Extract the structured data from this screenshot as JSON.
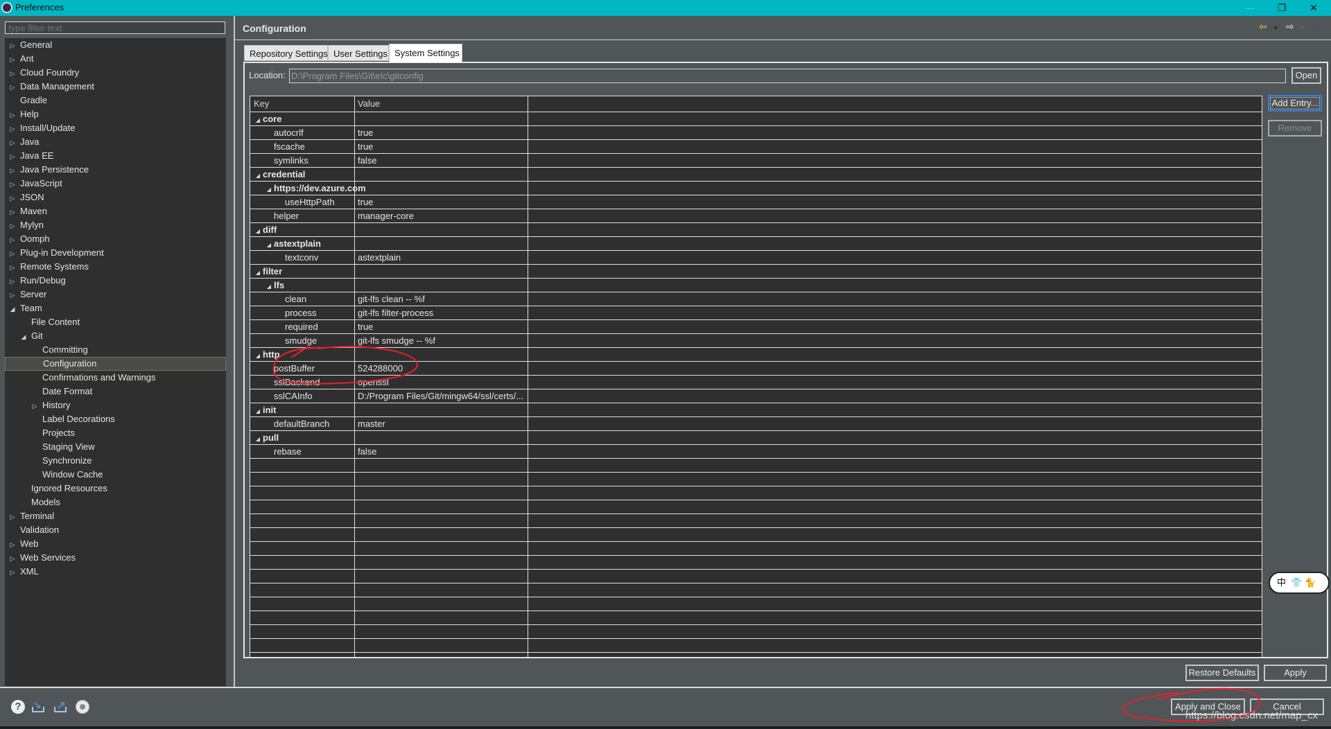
{
  "window": {
    "title": "Preferences",
    "controls": {
      "minimize": "—",
      "maximize": "❐",
      "close": "✕"
    }
  },
  "sidebar": {
    "filter_placeholder": "type filter text",
    "selected": "Configuration",
    "items": [
      {
        "label": "General",
        "level": 0,
        "toggle": "collapsed"
      },
      {
        "label": "Ant",
        "level": 0,
        "toggle": "collapsed"
      },
      {
        "label": "Cloud Foundry",
        "level": 0,
        "toggle": "collapsed"
      },
      {
        "label": "Data Management",
        "level": 0,
        "toggle": "collapsed"
      },
      {
        "label": "Gradle",
        "level": 0,
        "toggle": "none"
      },
      {
        "label": "Help",
        "level": 0,
        "toggle": "collapsed"
      },
      {
        "label": "Install/Update",
        "level": 0,
        "toggle": "collapsed"
      },
      {
        "label": "Java",
        "level": 0,
        "toggle": "collapsed"
      },
      {
        "label": "Java EE",
        "level": 0,
        "toggle": "collapsed"
      },
      {
        "label": "Java Persistence",
        "level": 0,
        "toggle": "collapsed"
      },
      {
        "label": "JavaScript",
        "level": 0,
        "toggle": "collapsed"
      },
      {
        "label": "JSON",
        "level": 0,
        "toggle": "collapsed"
      },
      {
        "label": "Maven",
        "level": 0,
        "toggle": "collapsed"
      },
      {
        "label": "Mylyn",
        "level": 0,
        "toggle": "collapsed"
      },
      {
        "label": "Oomph",
        "level": 0,
        "toggle": "collapsed"
      },
      {
        "label": "Plug-in Development",
        "level": 0,
        "toggle": "collapsed"
      },
      {
        "label": "Remote Systems",
        "level": 0,
        "toggle": "collapsed"
      },
      {
        "label": "Run/Debug",
        "level": 0,
        "toggle": "collapsed"
      },
      {
        "label": "Server",
        "level": 0,
        "toggle": "collapsed"
      },
      {
        "label": "Team",
        "level": 0,
        "toggle": "expanded"
      },
      {
        "label": "File Content",
        "level": 1,
        "toggle": "none"
      },
      {
        "label": "Git",
        "level": 1,
        "toggle": "expanded"
      },
      {
        "label": "Committing",
        "level": 2,
        "toggle": "none"
      },
      {
        "label": "Configuration",
        "level": 2,
        "toggle": "none"
      },
      {
        "label": "Confirmations and Warnings",
        "level": 2,
        "toggle": "none"
      },
      {
        "label": "Date Format",
        "level": 2,
        "toggle": "none"
      },
      {
        "label": "History",
        "level": 2,
        "toggle": "collapsed"
      },
      {
        "label": "Label Decorations",
        "level": 2,
        "toggle": "none"
      },
      {
        "label": "Projects",
        "level": 2,
        "toggle": "none"
      },
      {
        "label": "Staging View",
        "level": 2,
        "toggle": "none"
      },
      {
        "label": "Synchronize",
        "level": 2,
        "toggle": "none"
      },
      {
        "label": "Window Cache",
        "level": 2,
        "toggle": "none"
      },
      {
        "label": "Ignored Resources",
        "level": 1,
        "toggle": "none"
      },
      {
        "label": "Models",
        "level": 1,
        "toggle": "none"
      },
      {
        "label": "Terminal",
        "level": 0,
        "toggle": "collapsed"
      },
      {
        "label": "Validation",
        "level": 0,
        "toggle": "none"
      },
      {
        "label": "Web",
        "level": 0,
        "toggle": "collapsed"
      },
      {
        "label": "Web Services",
        "level": 0,
        "toggle": "collapsed"
      },
      {
        "label": "XML",
        "level": 0,
        "toggle": "collapsed"
      }
    ]
  },
  "header": {
    "title": "Configuration",
    "nav": {
      "back": "⇦",
      "forward": "⇨",
      "dropdown": "▾"
    }
  },
  "tabs": [
    {
      "label": "Repository Settings",
      "active": false
    },
    {
      "label": "User Settings",
      "active": false
    },
    {
      "label": "System Settings",
      "active": true
    }
  ],
  "location": {
    "label": "Location:",
    "value": "D:\\Program Files\\Git\\etc\\gitconfig",
    "open_button": "Open"
  },
  "side_buttons": {
    "add": "Add Entry...",
    "remove": "Remove"
  },
  "table": {
    "columns": [
      "Key",
      "Value"
    ],
    "rows": [
      {
        "key": "core",
        "value": "",
        "level": 0,
        "group": true
      },
      {
        "key": "autocrlf",
        "value": "true",
        "level": 1,
        "group": false
      },
      {
        "key": "fscache",
        "value": "true",
        "level": 1,
        "group": false
      },
      {
        "key": "symlinks",
        "value": "false",
        "level": 1,
        "group": false
      },
      {
        "key": "credential",
        "value": "",
        "level": 0,
        "group": true
      },
      {
        "key": "https://dev.azure.com",
        "value": "",
        "level": 1,
        "group": true
      },
      {
        "key": "useHttpPath",
        "value": "true",
        "level": 2,
        "group": false
      },
      {
        "key": "helper",
        "value": "manager-core",
        "level": 1,
        "group": false
      },
      {
        "key": "diff",
        "value": "",
        "level": 0,
        "group": true
      },
      {
        "key": "astextplain",
        "value": "",
        "level": 1,
        "group": true
      },
      {
        "key": "textconv",
        "value": "astextplain",
        "level": 2,
        "group": false
      },
      {
        "key": "filter",
        "value": "",
        "level": 0,
        "group": true
      },
      {
        "key": "lfs",
        "value": "",
        "level": 1,
        "group": true
      },
      {
        "key": "clean",
        "value": "git-lfs clean -- %f",
        "level": 2,
        "group": false
      },
      {
        "key": "process",
        "value": "git-lfs filter-process",
        "level": 2,
        "group": false
      },
      {
        "key": "required",
        "value": "true",
        "level": 2,
        "group": false
      },
      {
        "key": "smudge",
        "value": "git-lfs smudge -- %f",
        "level": 2,
        "group": false
      },
      {
        "key": "http",
        "value": "",
        "level": 0,
        "group": true
      },
      {
        "key": "postBuffer",
        "value": "524288000",
        "level": 1,
        "group": false
      },
      {
        "key": "sslBackend",
        "value": "openssl",
        "level": 1,
        "group": false
      },
      {
        "key": "sslCAInfo",
        "value": "D:/Program Files/Git/mingw64/ssl/certs/...",
        "level": 1,
        "group": false
      },
      {
        "key": "init",
        "value": "",
        "level": 0,
        "group": true
      },
      {
        "key": "defaultBranch",
        "value": "master",
        "level": 1,
        "group": false
      },
      {
        "key": "pull",
        "value": "",
        "level": 0,
        "group": true
      },
      {
        "key": "rebase",
        "value": "false",
        "level": 1,
        "group": false
      }
    ]
  },
  "footer": {
    "restore_defaults": "Restore Defaults",
    "apply": "Apply",
    "apply_and_close": "Apply and Close",
    "cancel": "Cancel",
    "help_icon": "?"
  },
  "ime_indicator": "中",
  "watermark": "https://blog.csdn.net/map_cx",
  "colors": {
    "titlebar": "#01b7c4",
    "background": "#505558",
    "tree_bg": "#2f2f2f",
    "annotation": "#e8202a",
    "focus": "#2f7fd8"
  }
}
